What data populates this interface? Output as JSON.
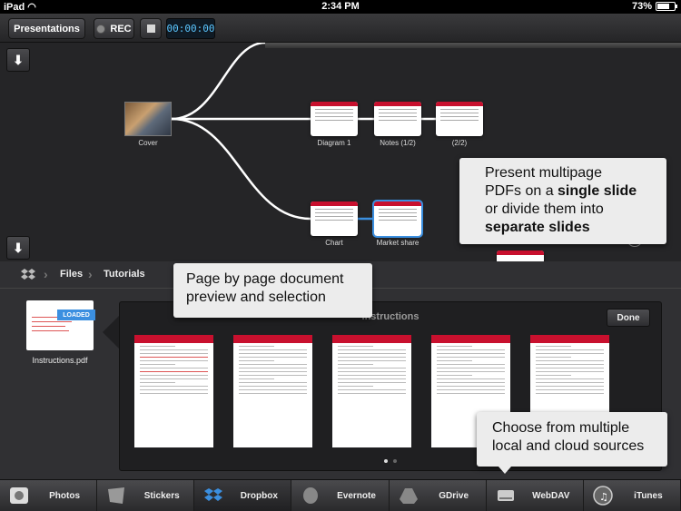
{
  "status_bar": {
    "device": "iPad",
    "time": "2:34 PM",
    "battery": "73%",
    "battery_level": 0.73
  },
  "toolbar": {
    "presentations_label": "Presentations",
    "rec_label": "REC",
    "timer": "00:00:00"
  },
  "canvas": {
    "nodes": [
      {
        "label": "Cover"
      },
      {
        "label": "Diagram 1"
      },
      {
        "label": "Notes (1/2)"
      },
      {
        "label": "(2/2)"
      },
      {
        "label": "Chart"
      },
      {
        "label": "Market share"
      }
    ],
    "callout_multipage": {
      "line1": "Present multipage",
      "line2a": "PDFs on a ",
      "line2b": "single slide",
      "line3": "or divide them into",
      "line4": "separate slides"
    },
    "callout_preview": {
      "line1": "Page by page document",
      "line2": "preview and selection"
    },
    "callout_sources": {
      "line1": "Choose from multiple",
      "line2": "local and cloud sources"
    }
  },
  "browser": {
    "breadcrumbs": [
      "Files",
      "Tutorials"
    ],
    "loaded_badge": "LOADED",
    "file_name": "Instructions.pdf",
    "preview_title": "Instructions",
    "done_label": "Done",
    "page_count": 2,
    "current_page": 1
  },
  "sources": [
    {
      "label": "Photos",
      "icon": "photos-icon"
    },
    {
      "label": "Stickers",
      "icon": "stickers-icon"
    },
    {
      "label": "Dropbox",
      "icon": "dropbox-icon"
    },
    {
      "label": "Evernote",
      "icon": "evernote-icon"
    },
    {
      "label": "GDrive",
      "icon": "gdrive-icon"
    },
    {
      "label": "WebDAV",
      "icon": "webdav-icon"
    },
    {
      "label": "iTunes",
      "icon": "itunes-icon"
    }
  ],
  "colors": {
    "accent": "#3b8fe0",
    "brand_red": "#c8102e",
    "timer_text": "#5bc6ff"
  }
}
